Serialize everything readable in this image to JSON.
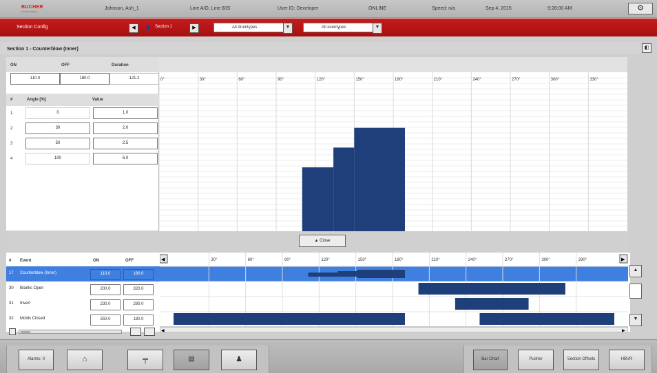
{
  "topbar": {
    "logo_main": "BUCHER",
    "logo_sub": "emhart glass",
    "user": "Johnson, Ash_1",
    "line": "Line A/O, Line 60S",
    "user_id": "User ID: Developer",
    "status": "ONLINE",
    "speed": "Speed: n/a",
    "date": "Sep 4, 2015",
    "time": "9:28:00 AM"
  },
  "redbar": {
    "section_config": "Section Config",
    "section_label": "Section 1",
    "drum_filter": "All drumtypes",
    "event_filter": "All eventypes"
  },
  "section": {
    "title": "Section 1 - Counterblow (Inner)"
  },
  "params": {
    "on_label": "ON",
    "off_label": "OFF",
    "duration_label": "Duration",
    "on_value": "110.0",
    "off_value": "180.0",
    "duration_value": "121.2",
    "col_num": "#",
    "col_angle": "Angle [%]",
    "col_value": "Value",
    "rows": [
      {
        "num": "1",
        "angle": "0",
        "value": "1.0"
      },
      {
        "num": "2",
        "angle": "30",
        "value": "2.0"
      },
      {
        "num": "3",
        "angle": "50",
        "value": "2.5"
      },
      {
        "num": "4",
        "angle": "100",
        "value": "6.0"
      }
    ]
  },
  "chart_data": {
    "type": "bar",
    "x_ticks": [
      "0°",
      "30°",
      "60°",
      "90°",
      "120°",
      "150°",
      "180°",
      "210°",
      "240°",
      "270°",
      "300°",
      "330°"
    ],
    "xlim": [
      0,
      360
    ],
    "ylim": [
      0,
      10
    ],
    "bars": [
      {
        "x0": 110,
        "x1": 134,
        "y": 4.2
      },
      {
        "x0": 134,
        "x1": 150,
        "y": 5.5
      },
      {
        "x0": 150,
        "x1": 189,
        "y": 6.8
      }
    ],
    "color": "#1f3f7a"
  },
  "close_button": "▲ Close",
  "events": {
    "col_num": "#",
    "col_event": "Event",
    "col_on": "ON",
    "col_off": "OFF",
    "timeline_ticks": [
      "30°",
      "60°",
      "90°",
      "120°",
      "150°",
      "180°",
      "210°",
      "240°",
      "270°",
      "300°",
      "330°"
    ],
    "rows": [
      {
        "num": "17",
        "name": "Counterblow (Inner)",
        "on": "110.0",
        "off": "180.0",
        "selected": true
      },
      {
        "num": "30",
        "name": "Blanks Open",
        "on": "200.0",
        "off": "320.0",
        "selected": false
      },
      {
        "num": "31",
        "name": "Invert",
        "on": "230.0",
        "off": "280.0",
        "selected": false
      },
      {
        "num": "32",
        "name": "Molds Closed",
        "on": "250.0",
        "off": "180.0",
        "selected": false
      }
    ],
    "timeline_color": "#1f3f7a"
  },
  "bottom": {
    "alarms": "Alarms: 0",
    "bar_chart": "Bar Chart",
    "pusher": "Pusher",
    "section_offsets": "Section Offsets",
    "hbvr": "HBVR"
  }
}
